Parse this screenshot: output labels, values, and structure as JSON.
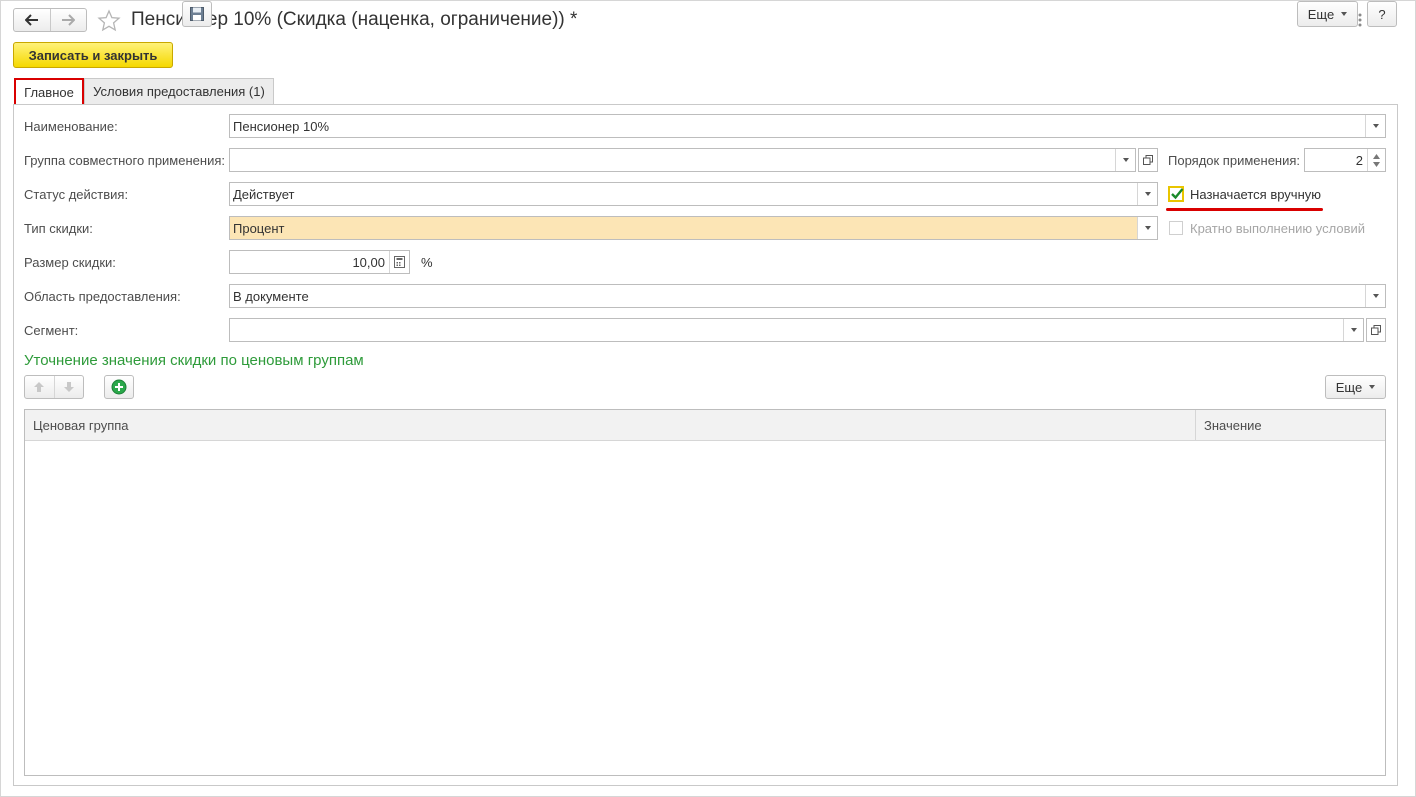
{
  "window": {
    "title": "Пенсионер 10% (Скидка (наценка, ограничение)) *"
  },
  "toolbar": {
    "save_close_label": "Записать и закрыть",
    "more_label": "Еще",
    "help_label": "?"
  },
  "tabs": [
    {
      "label": "Главное",
      "active": true
    },
    {
      "label": "Условия предоставления (1)",
      "active": false
    }
  ],
  "form": {
    "name": {
      "label": "Наименование:",
      "value": "Пенсионер 10%"
    },
    "group": {
      "label": "Группа совместного применения:",
      "value": ""
    },
    "order": {
      "label": "Порядок применения:",
      "value": "2"
    },
    "status": {
      "label": "Статус действия:",
      "value": "Действует"
    },
    "manual": {
      "label": "Назначается вручную",
      "checked": true
    },
    "type": {
      "label": "Тип скидки:",
      "value": "Процент"
    },
    "multiple": {
      "label": "Кратно выполнению условий",
      "checked": false,
      "disabled": true
    },
    "size": {
      "label": "Размер скидки:",
      "value": "10,00",
      "unit": "%"
    },
    "area": {
      "label": "Область предоставления:",
      "value": "В документе"
    },
    "segment": {
      "label": "Сегмент:",
      "value": ""
    }
  },
  "price_groups": {
    "title": "Уточнение значения скидки по ценовым группам",
    "more_label": "Еще",
    "columns": [
      "Ценовая группа",
      "Значение"
    ],
    "rows": []
  },
  "colors": {
    "accent_yellow": "#f5d800",
    "highlight_field": "#fce5b5",
    "section_green": "#2e9b3a",
    "annotation_red": "#d90000"
  }
}
